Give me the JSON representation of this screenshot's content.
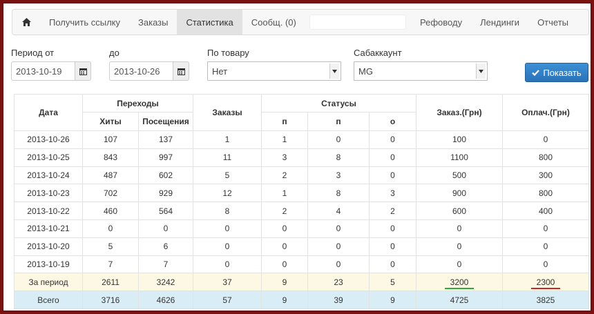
{
  "nav": {
    "items": [
      {
        "label": "Получить ссылку"
      },
      {
        "label": "Заказы"
      },
      {
        "label": "Статистика"
      },
      {
        "label": "Сообщ. (0)"
      }
    ],
    "right_items": [
      {
        "label": "Рефоводу"
      },
      {
        "label": "Лендинги"
      },
      {
        "label": "Отчеты"
      }
    ]
  },
  "filters": {
    "period_from_label": "Период от",
    "period_from_value": "2013-10-19",
    "period_to_label": "до",
    "period_to_value": "2013-10-26",
    "product_label": "По товару",
    "product_value": "Нет",
    "subaccount_label": "Сабаккаунт",
    "subaccount_value": "MG",
    "show_button": "Показать"
  },
  "table": {
    "headers": {
      "date": "Дата",
      "transitions": "Переходы",
      "hits": "Хиты",
      "visits": "Посещения",
      "orders": "Заказы",
      "statuses": "Статусы",
      "status_p1": "п",
      "status_p2": "п",
      "status_o": "о",
      "ordered_sum": "Заказ.(Грн)",
      "paid_sum": "Оплач.(Грн)"
    },
    "rows": [
      {
        "date": "2013-10-26",
        "hits": "107",
        "visits": "137",
        "orders": "1",
        "s1": "1",
        "s2": "0",
        "s3": "0",
        "ordered": "100",
        "paid": "0"
      },
      {
        "date": "2013-10-25",
        "hits": "843",
        "visits": "997",
        "orders": "11",
        "s1": "3",
        "s2": "8",
        "s3": "0",
        "ordered": "1100",
        "paid": "800"
      },
      {
        "date": "2013-10-24",
        "hits": "487",
        "visits": "602",
        "orders": "5",
        "s1": "2",
        "s2": "3",
        "s3": "0",
        "ordered": "500",
        "paid": "300"
      },
      {
        "date": "2013-10-23",
        "hits": "702",
        "visits": "929",
        "orders": "12",
        "s1": "1",
        "s2": "8",
        "s3": "3",
        "ordered": "900",
        "paid": "800"
      },
      {
        "date": "2013-10-22",
        "hits": "460",
        "visits": "564",
        "orders": "8",
        "s1": "2",
        "s2": "4",
        "s3": "2",
        "ordered": "600",
        "paid": "400"
      },
      {
        "date": "2013-10-21",
        "hits": "0",
        "visits": "0",
        "orders": "0",
        "s1": "0",
        "s2": "0",
        "s3": "0",
        "ordered": "0",
        "paid": "0"
      },
      {
        "date": "2013-10-20",
        "hits": "5",
        "visits": "6",
        "orders": "0",
        "s1": "0",
        "s2": "0",
        "s3": "0",
        "ordered": "0",
        "paid": "0"
      },
      {
        "date": "2013-10-19",
        "hits": "7",
        "visits": "7",
        "orders": "0",
        "s1": "0",
        "s2": "0",
        "s3": "0",
        "ordered": "0",
        "paid": "0"
      }
    ],
    "period": {
      "label": "За период",
      "hits": "2611",
      "visits": "3242",
      "orders": "37",
      "s1": "9",
      "s2": "23",
      "s3": "5",
      "ordered": "3200",
      "paid": "2300"
    },
    "total": {
      "label": "Всего",
      "hits": "3716",
      "visits": "4626",
      "orders": "57",
      "s1": "9",
      "s2": "39",
      "s3": "9",
      "ordered": "4725",
      "paid": "3825"
    }
  },
  "colors": {
    "frame": "#7a1212",
    "primary_button": "#2f7fc8",
    "period_row": "#fcf8e3",
    "total_row": "#d9edf7",
    "underline_green": "#2eaa3a",
    "underline_red": "#c62828"
  },
  "icons": [
    "home-icon",
    "calendar-icon",
    "dropdown-arrow-icon",
    "checkmark-icon"
  ]
}
